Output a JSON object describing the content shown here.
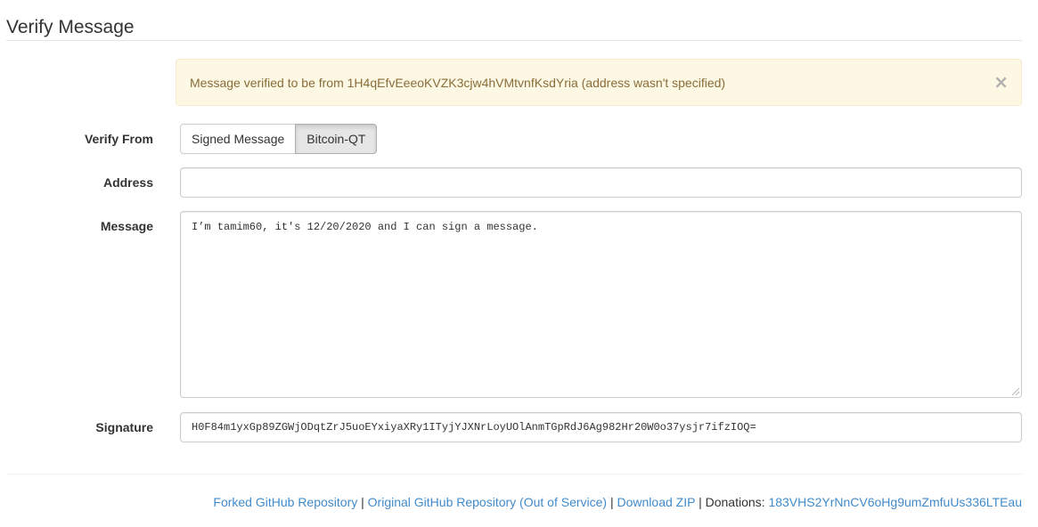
{
  "page": {
    "title": "Verify Message"
  },
  "alert": {
    "message": "Message verified to be from 1H4qEfvEeeoKVZK3cjw4hVMtvnfKsdYria (address wasn't specified)",
    "close": "×"
  },
  "form": {
    "verify_from": {
      "label": "Verify From",
      "options": [
        "Signed Message",
        "Bitcoin-QT"
      ],
      "selected": "Bitcoin-QT"
    },
    "address": {
      "label": "Address",
      "value": ""
    },
    "message": {
      "label": "Message",
      "value": "I’m tamim60, it's 12/20/2020 and I can sign a message."
    },
    "signature": {
      "label": "Signature",
      "value": "H0F84m1yxGp89ZGWjODqtZrJ5uoEYxiyaXRy1ITyjYJXNrLoyUOlAnmTGpRdJ6Ag982Hr20W0o37ysjr7ifzIOQ="
    }
  },
  "footer": {
    "forked_repo": "Forked GitHub Repository",
    "original_repo": "Original GitHub Repository (Out of Service)",
    "download_zip": "Download ZIP",
    "separator": "|",
    "donations_label": "Donations:",
    "donations_address": "183VHS2YrNnCV6oHg9umZmfuUs336LTEau"
  }
}
